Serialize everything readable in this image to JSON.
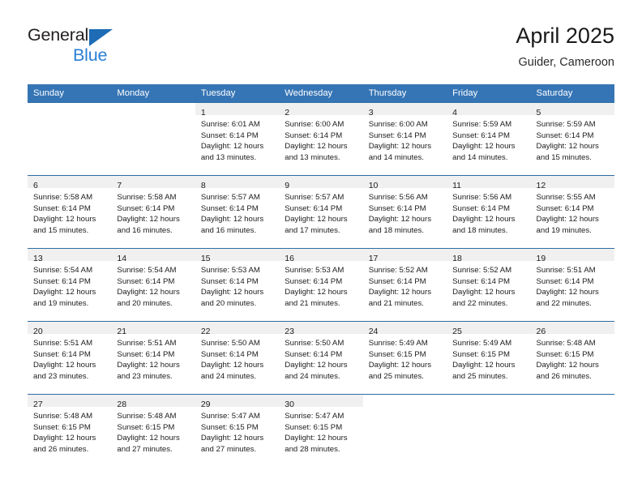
{
  "brand": {
    "line1": "General",
    "line2": "Blue",
    "triangle_color": "#1d6cb5",
    "text_color": "#231f20",
    "blue_text_color": "#2a7fd4"
  },
  "header": {
    "title": "April 2025",
    "subtitle": "Guider, Cameroon"
  },
  "theme": {
    "header_bg": "#3575b5",
    "week_divider": "#2e6da4",
    "daynum_band_bg": "#f0f0f0"
  },
  "weekdays": [
    "Sunday",
    "Monday",
    "Tuesday",
    "Wednesday",
    "Thursday",
    "Friday",
    "Saturday"
  ],
  "weeks": [
    [
      {
        "day": "",
        "lines": [
          "",
          "",
          "",
          ""
        ]
      },
      {
        "day": "",
        "lines": [
          "",
          "",
          "",
          ""
        ]
      },
      {
        "day": "1",
        "lines": [
          "Sunrise: 6:01 AM",
          "Sunset: 6:14 PM",
          "Daylight: 12 hours",
          "and 13 minutes."
        ]
      },
      {
        "day": "2",
        "lines": [
          "Sunrise: 6:00 AM",
          "Sunset: 6:14 PM",
          "Daylight: 12 hours",
          "and 13 minutes."
        ]
      },
      {
        "day": "3",
        "lines": [
          "Sunrise: 6:00 AM",
          "Sunset: 6:14 PM",
          "Daylight: 12 hours",
          "and 14 minutes."
        ]
      },
      {
        "day": "4",
        "lines": [
          "Sunrise: 5:59 AM",
          "Sunset: 6:14 PM",
          "Daylight: 12 hours",
          "and 14 minutes."
        ]
      },
      {
        "day": "5",
        "lines": [
          "Sunrise: 5:59 AM",
          "Sunset: 6:14 PM",
          "Daylight: 12 hours",
          "and 15 minutes."
        ]
      }
    ],
    [
      {
        "day": "6",
        "lines": [
          "Sunrise: 5:58 AM",
          "Sunset: 6:14 PM",
          "Daylight: 12 hours",
          "and 15 minutes."
        ]
      },
      {
        "day": "7",
        "lines": [
          "Sunrise: 5:58 AM",
          "Sunset: 6:14 PM",
          "Daylight: 12 hours",
          "and 16 minutes."
        ]
      },
      {
        "day": "8",
        "lines": [
          "Sunrise: 5:57 AM",
          "Sunset: 6:14 PM",
          "Daylight: 12 hours",
          "and 16 minutes."
        ]
      },
      {
        "day": "9",
        "lines": [
          "Sunrise: 5:57 AM",
          "Sunset: 6:14 PM",
          "Daylight: 12 hours",
          "and 17 minutes."
        ]
      },
      {
        "day": "10",
        "lines": [
          "Sunrise: 5:56 AM",
          "Sunset: 6:14 PM",
          "Daylight: 12 hours",
          "and 18 minutes."
        ]
      },
      {
        "day": "11",
        "lines": [
          "Sunrise: 5:56 AM",
          "Sunset: 6:14 PM",
          "Daylight: 12 hours",
          "and 18 minutes."
        ]
      },
      {
        "day": "12",
        "lines": [
          "Sunrise: 5:55 AM",
          "Sunset: 6:14 PM",
          "Daylight: 12 hours",
          "and 19 minutes."
        ]
      }
    ],
    [
      {
        "day": "13",
        "lines": [
          "Sunrise: 5:54 AM",
          "Sunset: 6:14 PM",
          "Daylight: 12 hours",
          "and 19 minutes."
        ]
      },
      {
        "day": "14",
        "lines": [
          "Sunrise: 5:54 AM",
          "Sunset: 6:14 PM",
          "Daylight: 12 hours",
          "and 20 minutes."
        ]
      },
      {
        "day": "15",
        "lines": [
          "Sunrise: 5:53 AM",
          "Sunset: 6:14 PM",
          "Daylight: 12 hours",
          "and 20 minutes."
        ]
      },
      {
        "day": "16",
        "lines": [
          "Sunrise: 5:53 AM",
          "Sunset: 6:14 PM",
          "Daylight: 12 hours",
          "and 21 minutes."
        ]
      },
      {
        "day": "17",
        "lines": [
          "Sunrise: 5:52 AM",
          "Sunset: 6:14 PM",
          "Daylight: 12 hours",
          "and 21 minutes."
        ]
      },
      {
        "day": "18",
        "lines": [
          "Sunrise: 5:52 AM",
          "Sunset: 6:14 PM",
          "Daylight: 12 hours",
          "and 22 minutes."
        ]
      },
      {
        "day": "19",
        "lines": [
          "Sunrise: 5:51 AM",
          "Sunset: 6:14 PM",
          "Daylight: 12 hours",
          "and 22 minutes."
        ]
      }
    ],
    [
      {
        "day": "20",
        "lines": [
          "Sunrise: 5:51 AM",
          "Sunset: 6:14 PM",
          "Daylight: 12 hours",
          "and 23 minutes."
        ]
      },
      {
        "day": "21",
        "lines": [
          "Sunrise: 5:51 AM",
          "Sunset: 6:14 PM",
          "Daylight: 12 hours",
          "and 23 minutes."
        ]
      },
      {
        "day": "22",
        "lines": [
          "Sunrise: 5:50 AM",
          "Sunset: 6:14 PM",
          "Daylight: 12 hours",
          "and 24 minutes."
        ]
      },
      {
        "day": "23",
        "lines": [
          "Sunrise: 5:50 AM",
          "Sunset: 6:14 PM",
          "Daylight: 12 hours",
          "and 24 minutes."
        ]
      },
      {
        "day": "24",
        "lines": [
          "Sunrise: 5:49 AM",
          "Sunset: 6:15 PM",
          "Daylight: 12 hours",
          "and 25 minutes."
        ]
      },
      {
        "day": "25",
        "lines": [
          "Sunrise: 5:49 AM",
          "Sunset: 6:15 PM",
          "Daylight: 12 hours",
          "and 25 minutes."
        ]
      },
      {
        "day": "26",
        "lines": [
          "Sunrise: 5:48 AM",
          "Sunset: 6:15 PM",
          "Daylight: 12 hours",
          "and 26 minutes."
        ]
      }
    ],
    [
      {
        "day": "27",
        "lines": [
          "Sunrise: 5:48 AM",
          "Sunset: 6:15 PM",
          "Daylight: 12 hours",
          "and 26 minutes."
        ]
      },
      {
        "day": "28",
        "lines": [
          "Sunrise: 5:48 AM",
          "Sunset: 6:15 PM",
          "Daylight: 12 hours",
          "and 27 minutes."
        ]
      },
      {
        "day": "29",
        "lines": [
          "Sunrise: 5:47 AM",
          "Sunset: 6:15 PM",
          "Daylight: 12 hours",
          "and 27 minutes."
        ]
      },
      {
        "day": "30",
        "lines": [
          "Sunrise: 5:47 AM",
          "Sunset: 6:15 PM",
          "Daylight: 12 hours",
          "and 28 minutes."
        ]
      },
      {
        "day": "",
        "lines": [
          "",
          "",
          "",
          ""
        ]
      },
      {
        "day": "",
        "lines": [
          "",
          "",
          "",
          ""
        ]
      },
      {
        "day": "",
        "lines": [
          "",
          "",
          "",
          ""
        ]
      }
    ]
  ]
}
